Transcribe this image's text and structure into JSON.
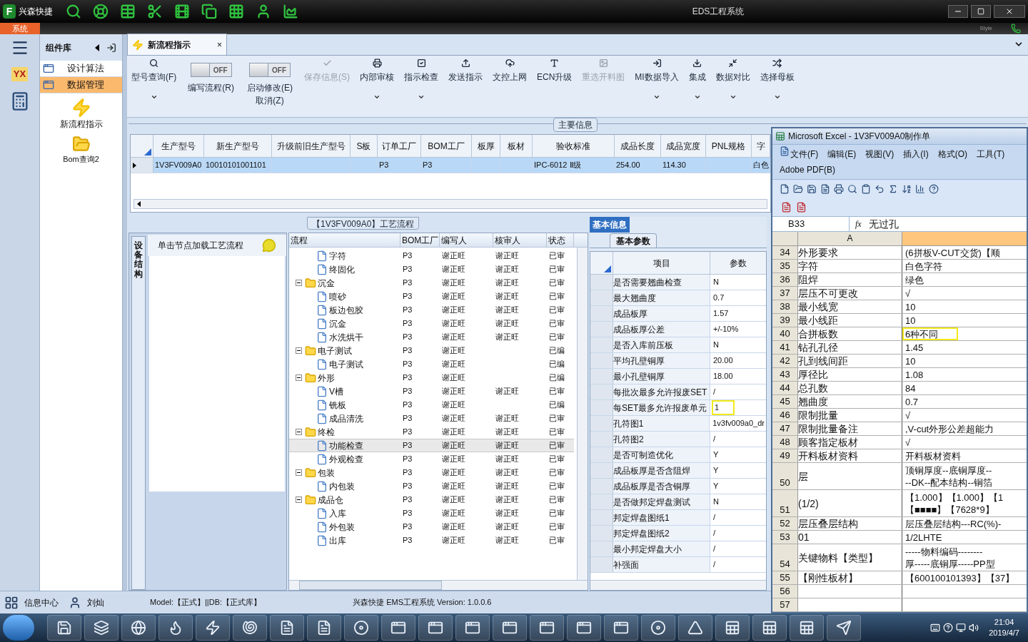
{
  "title_bar": {
    "logo": "F",
    "app_name": "兴森快捷",
    "title": "EDS工程系统",
    "style_label": "Style"
  },
  "system_tab": "系统",
  "side_strip": {
    "logo": "YX"
  },
  "component_panel": {
    "title": "组件库",
    "items": [
      {
        "label": "设计算法",
        "selected": false
      },
      {
        "label": "数据管理",
        "selected": true
      }
    ],
    "tools": [
      "新流程指示",
      "Bom查询2"
    ]
  },
  "document_tab": {
    "label": "新流程指示",
    "close": "×"
  },
  "toolbar": [
    {
      "kind": "button",
      "label": "型号查询(F)",
      "disabled": false,
      "dropdown": true
    },
    {
      "kind": "toggle",
      "label": "编写流程(R)",
      "text": "OFF",
      "on": false
    },
    {
      "kind": "toggle",
      "label": "启动修改(E)",
      "sublabel": "取消(Z)",
      "text": "OFF",
      "on": false
    },
    {
      "kind": "button",
      "label": "保存信息(S)",
      "disabled": true,
      "dropdown": false
    },
    {
      "kind": "button",
      "label": "内部审核",
      "disabled": false,
      "dropdown": true
    },
    {
      "kind": "button",
      "label": "指示检查",
      "disabled": false,
      "dropdown": true
    },
    {
      "kind": "button",
      "label": "发送指示",
      "disabled": false,
      "dropdown": false
    },
    {
      "kind": "button",
      "label": "文控上网",
      "disabled": false,
      "dropdown": false
    },
    {
      "kind": "button",
      "label": "ECN升级",
      "disabled": false,
      "dropdown": false
    },
    {
      "kind": "button",
      "label": "重选开料图",
      "disabled": true,
      "dropdown": false
    },
    {
      "kind": "button",
      "label": "MI数据导入",
      "disabled": false,
      "dropdown": true
    },
    {
      "kind": "button",
      "label": "集成",
      "disabled": false,
      "dropdown": true
    },
    {
      "kind": "button",
      "label": "数据对比",
      "disabled": false,
      "dropdown": true
    },
    {
      "kind": "button",
      "label": "选择母板",
      "disabled": false,
      "dropdown": true
    }
  ],
  "main_info": {
    "legend": "主要信息",
    "columns": [
      "生产型号",
      "新生产型号",
      "升级前旧生产型号",
      "S板",
      "订单工厂",
      "BOM工厂",
      "板厚",
      "板材",
      "验收标准",
      "成品长度",
      "成品宽度",
      "PNL规格",
      "字"
    ],
    "rows": [
      {
        "selected": true,
        "cells": [
          "1V3FV009A0",
          "10010101001101",
          "",
          "",
          "P3",
          "P3",
          "",
          "",
          "IPC-6012 Ⅱ级",
          "254.00",
          "114.30",
          "",
          "白色"
        ]
      }
    ]
  },
  "process_panel": {
    "side_tab": "设备结构",
    "hint": "单击节点加载工艺流程"
  },
  "process_tree": {
    "legend": "【1V3FV009A0】工艺流程",
    "columns": [
      "流程",
      "BOM工厂",
      "编写人",
      "核审人",
      "状态"
    ],
    "nodes": [
      {
        "children": [
          {
            "label": "字符",
            "bom": "P3",
            "writer": "谢正旺",
            "reviewer": "谢正旺",
            "status": "已审",
            "selected": false
          },
          {
            "label": "终固化",
            "bom": "P3",
            "writer": "谢正旺",
            "reviewer": "谢正旺",
            "status": "已审",
            "selected": false
          }
        ]
      },
      {
        "label": "沉金",
        "bom": "P3",
        "writer": "谢正旺",
        "reviewer": "谢正旺",
        "status": "已审",
        "selected": false,
        "expanded": true,
        "children": [
          {
            "label": "喷砂",
            "bom": "P3",
            "writer": "谢正旺",
            "reviewer": "谢正旺",
            "status": "已审",
            "selected": false
          },
          {
            "label": "板边包胶",
            "bom": "P3",
            "writer": "谢正旺",
            "reviewer": "谢正旺",
            "status": "已审",
            "selected": false
          },
          {
            "label": "沉金",
            "bom": "P3",
            "writer": "谢正旺",
            "reviewer": "谢正旺",
            "status": "已审",
            "selected": false
          },
          {
            "label": "水洗烘干",
            "bom": "P3",
            "writer": "谢正旺",
            "reviewer": "谢正旺",
            "status": "已审",
            "selected": false
          }
        ]
      },
      {
        "label": "电子测试",
        "bom": "P3",
        "writer": "谢正旺",
        "status": "已编",
        "selected": false,
        "expanded": true,
        "children": [
          {
            "label": "电子测试",
            "bom": "P3",
            "writer": "谢正旺",
            "status": "已编",
            "selected": false
          }
        ]
      },
      {
        "label": "外形",
        "bom": "P3",
        "writer": "谢正旺",
        "status": "已编",
        "selected": false,
        "expanded": true,
        "children": [
          {
            "label": "V槽",
            "bom": "P3",
            "writer": "谢正旺",
            "reviewer": "谢正旺",
            "status": "已审",
            "selected": false
          },
          {
            "label": "铣板",
            "bom": "P3",
            "writer": "谢正旺",
            "status": "已编",
            "selected": false
          },
          {
            "label": "成品清洗",
            "bom": "P3",
            "writer": "谢正旺",
            "reviewer": "谢正旺",
            "status": "已审",
            "selected": false
          }
        ]
      },
      {
        "label": "终检",
        "bom": "P3",
        "writer": "谢正旺",
        "reviewer": "谢正旺",
        "status": "已审",
        "selected": false,
        "expanded": true,
        "children": [
          {
            "label": "功能检查",
            "bom": "P3",
            "writer": "谢正旺",
            "reviewer": "谢正旺",
            "status": "已审",
            "selected": true
          },
          {
            "label": "外观检查",
            "bom": "P3",
            "writer": "谢正旺",
            "reviewer": "谢正旺",
            "status": "已审",
            "selected": false
          }
        ]
      },
      {
        "label": "包装",
        "bom": "P3",
        "writer": "谢正旺",
        "reviewer": "谢正旺",
        "status": "已审",
        "selected": false,
        "expanded": true,
        "children": [
          {
            "label": "内包装",
            "bom": "P3",
            "writer": "谢正旺",
            "reviewer": "谢正旺",
            "status": "已审",
            "selected": false
          }
        ]
      },
      {
        "label": "成品仓",
        "bom": "P3",
        "writer": "谢正旺",
        "reviewer": "谢正旺",
        "status": "已审",
        "selected": false,
        "expanded": true,
        "children": [
          {
            "label": "入库",
            "bom": "P3",
            "writer": "谢正旺",
            "reviewer": "谢正旺",
            "status": "已审",
            "selected": false
          },
          {
            "label": "外包装",
            "bom": "P3",
            "writer": "谢正旺",
            "reviewer": "谢正旺",
            "status": "已审",
            "selected": false
          },
          {
            "label": "出库",
            "bom": "P3",
            "writer": "谢正旺",
            "reviewer": "谢正旺",
            "status": "已审",
            "selected": false
          }
        ]
      }
    ]
  },
  "params": {
    "section_tab": "基本信息",
    "sub_tab": "基本参数",
    "columns": [
      "项目",
      "参数"
    ],
    "rows": [
      {
        "item": "是否需要翘曲检查",
        "value": "N",
        "highlighted": false
      },
      {
        "item": "最大翘曲度",
        "value": "0.7",
        "highlighted": false
      },
      {
        "item": "成品板厚",
        "value": "1.57",
        "highlighted": false
      },
      {
        "item": "成品板厚公差",
        "value": "+/-10%",
        "highlighted": false
      },
      {
        "item": "是否入库前压板",
        "value": "N",
        "highlighted": false
      },
      {
        "item": "平均孔壁铜厚",
        "value": "20.00",
        "highlighted": false
      },
      {
        "item": "最小孔壁铜厚",
        "value": "18.00",
        "highlighted": false
      },
      {
        "item": "每批次最多允许报废SET",
        "value": "/",
        "highlighted": false
      },
      {
        "item": "每SET最多允许报废单元",
        "value": "1",
        "highlighted": true
      },
      {
        "item": "孔符图1",
        "value": "1v3fv009a0_dr",
        "highlighted": false
      },
      {
        "item": "孔符图2",
        "value": "/",
        "highlighted": false
      },
      {
        "item": "是否可制造优化",
        "value": "Y",
        "highlighted": false
      },
      {
        "item": "成品板厚是否含阻焊",
        "value": "Y",
        "highlighted": false
      },
      {
        "item": "成品板厚是否含铜厚",
        "value": "Y",
        "highlighted": false
      },
      {
        "item": "是否做邦定焊盘测试",
        "value": "N",
        "highlighted": false
      },
      {
        "item": "邦定焊盘图纸1",
        "value": "/",
        "highlighted": false
      },
      {
        "item": "邦定焊盘图纸2",
        "value": "/",
        "highlighted": false
      },
      {
        "item": "最小邦定焊盘大小",
        "value": "/",
        "highlighted": false
      },
      {
        "item": "补强面",
        "value": "/",
        "highlighted": false
      }
    ]
  },
  "excel": {
    "title": "Microsoft Excel - 1V3FV009A0制作单",
    "menus": [
      "文件(F)",
      "编辑(E)",
      "视图(V)",
      "插入(I)",
      "格式(O)",
      "工具(T)",
      "Adobe PDF(B)"
    ],
    "name_box": "B33",
    "fx_label": "fx",
    "formula": "无过孔",
    "column_a": "A",
    "rows": [
      {
        "num": "34",
        "a": "外形要求",
        "b": [
          "(6拼板V-CUT交货)【顺"
        ],
        "highlighted": false
      },
      {
        "num": "35",
        "a": "字符",
        "b": [
          "白色字符"
        ],
        "highlighted": false
      },
      {
        "num": "36",
        "a": "阻焊",
        "b": [
          "绿色"
        ],
        "highlighted": false
      },
      {
        "num": "37",
        "a": "层压不可更改",
        "b": [
          "√"
        ],
        "highlighted": false
      },
      {
        "num": "38",
        "a": "最小线宽",
        "b": [
          "10"
        ],
        "highlighted": false
      },
      {
        "num": "39",
        "a": "最小线距",
        "b": [
          "10"
        ],
        "highlighted": false
      },
      {
        "num": "40",
        "a": "合拼板数",
        "b": [
          "6种不同"
        ],
        "highlighted": true
      },
      {
        "num": "41",
        "a": "钻孔孔径",
        "b": [
          "1.45"
        ],
        "highlighted": false
      },
      {
        "num": "42",
        "a": "孔到线间距",
        "b": [
          "10"
        ],
        "highlighted": false
      },
      {
        "num": "43",
        "a": "厚径比",
        "b": [
          "1.08"
        ],
        "highlighted": false
      },
      {
        "num": "44",
        "a": "总孔数",
        "b": [
          "84"
        ],
        "highlighted": false
      },
      {
        "num": "45",
        "a": "翘曲度",
        "b": [
          "0.7"
        ],
        "highlighted": false
      },
      {
        "num": "46",
        "a": "限制批量",
        "b": [
          "√"
        ],
        "highlighted": false
      },
      {
        "num": "47",
        "a": "限制批量备注",
        "b": [
          ",V-cut外形公差超能力"
        ],
        "highlighted": false
      },
      {
        "num": "48",
        "a": "顾客指定板材",
        "b": [
          "√"
        ],
        "highlighted": false
      },
      {
        "num": "49",
        "a": "开料板材资料",
        "b": [
          "开料板材资料"
        ],
        "highlighted": false
      },
      {
        "num": "50",
        "a": "层",
        "b": [
          "顶铜厚度--底铜厚度--",
          "--DK--配本结构--铜箔"
        ],
        "highlighted": false
      },
      {
        "num": "51",
        "a": "(1/2)",
        "b": [
          "【1.000】【1.000】【1",
          "【■■■■】【7628*9】"
        ],
        "highlighted": false
      },
      {
        "num": "52",
        "a": "层压叠层结构",
        "b": [
          "层压叠层结构---RC(%)-"
        ],
        "highlighted": false
      },
      {
        "num": "53",
        "a": "01",
        "b": [
          "1/2LHTE"
        ],
        "highlighted": false
      },
      {
        "num": "54",
        "a": "关键物料【类型】",
        "b": [
          "-----物料编码--------",
          "厚-----底铜厚-----PP型"
        ],
        "highlighted": false
      },
      {
        "num": "55",
        "a": "【刚性板材】",
        "b": [
          "【600100101393】【37】"
        ],
        "highlighted": false
      },
      {
        "num": "56",
        "a": "",
        "b": [],
        "highlighted": false
      },
      {
        "num": "57",
        "a": "",
        "b": [],
        "highlighted": false
      }
    ]
  },
  "status_bar": {
    "info_center": "信息中心",
    "user": "刘灿",
    "model": "Model:【正式】||DB:【正式库】",
    "product": "兴森快捷 EMS工程系统 Version: 1.0.0.6"
  },
  "taskbar": {
    "time": "21:04",
    "date": "2019/4/7"
  }
}
